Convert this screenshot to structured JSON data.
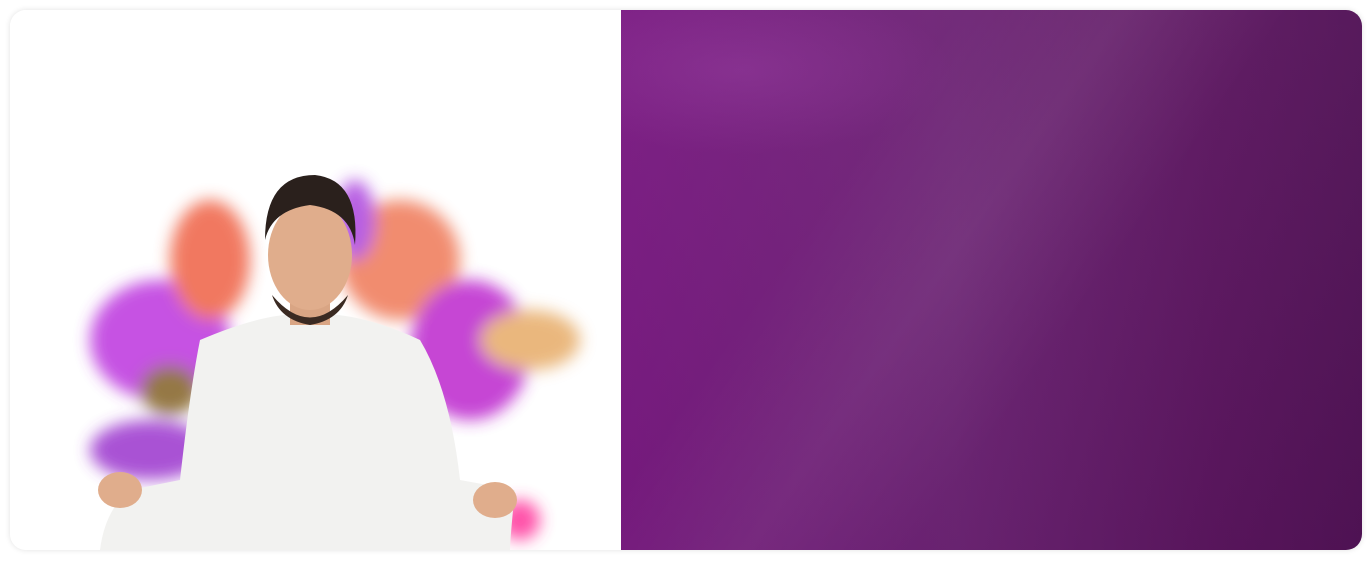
{
  "hero": {
    "image": "meditating-man-with-color-powder-burst",
    "panel_color": "#6e2576",
    "accent_colors": [
      "#c040e0",
      "#f07050",
      "#e8b070",
      "#ff40c0"
    ]
  }
}
